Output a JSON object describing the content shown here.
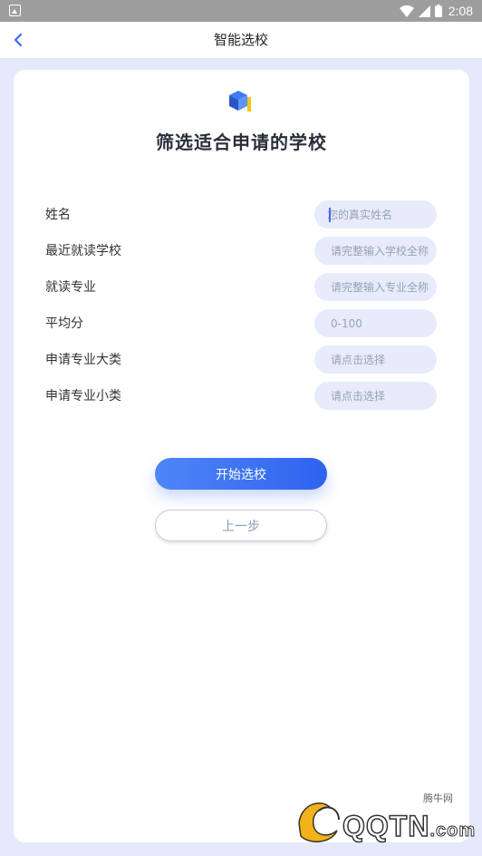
{
  "status_bar": {
    "time": "2:08"
  },
  "nav": {
    "title": "智能选校"
  },
  "card": {
    "title": "筛选适合申请的学校"
  },
  "form": {
    "rows": [
      {
        "label": "姓名",
        "placeholder": "您的真实姓名"
      },
      {
        "label": "最近就读学校",
        "placeholder": "请完整输入学校全称"
      },
      {
        "label": "就读专业",
        "placeholder": "请完整输入专业全称"
      },
      {
        "label": "平均分",
        "placeholder": "0-100"
      },
      {
        "label": "申请专业大类",
        "placeholder": "请点击选择"
      },
      {
        "label": "申请专业小类",
        "placeholder": "请点击选择"
      }
    ]
  },
  "buttons": {
    "start": "开始选校",
    "prev": "上一步"
  },
  "watermark": {
    "small": "腾牛网",
    "main": "QQTN",
    "suffix": ".com"
  },
  "colors": {
    "accent": "#3b6cf0",
    "page_bg": "#e6e9fb",
    "input_bg": "#e8ebfb"
  }
}
